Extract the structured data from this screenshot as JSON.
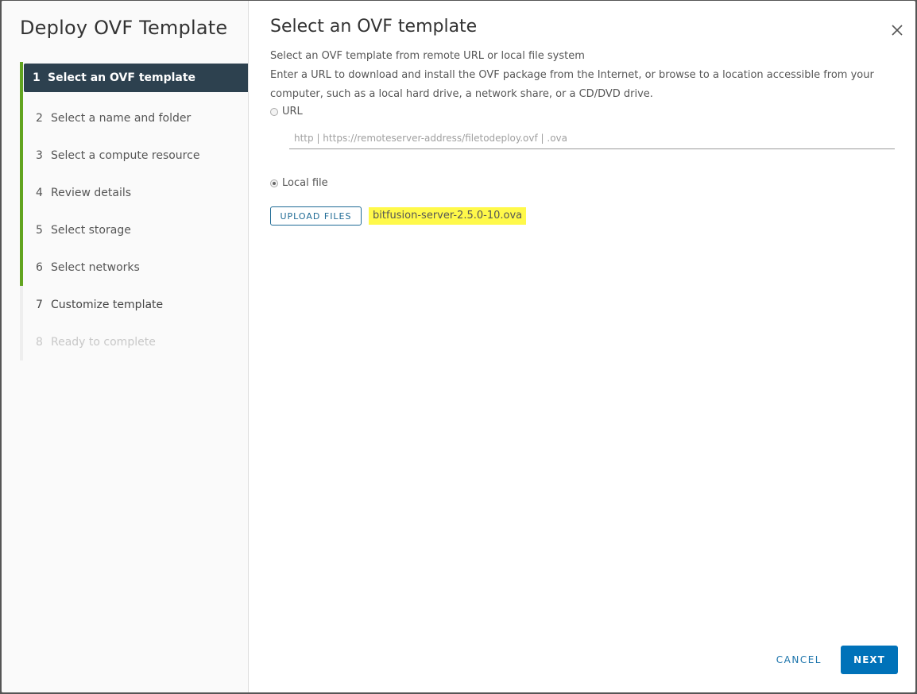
{
  "sidebar": {
    "title": "Deploy OVF Template",
    "steps": [
      {
        "num": "1",
        "label": "Select an OVF template",
        "state": "active"
      },
      {
        "num": "2",
        "label": "Select a name and folder",
        "state": "complete"
      },
      {
        "num": "3",
        "label": "Select a compute resource",
        "state": "complete"
      },
      {
        "num": "4",
        "label": "Review details",
        "state": "complete"
      },
      {
        "num": "5",
        "label": "Select storage",
        "state": "complete"
      },
      {
        "num": "6",
        "label": "Select networks",
        "state": "complete"
      },
      {
        "num": "7",
        "label": "Customize template",
        "state": "pending"
      },
      {
        "num": "8",
        "label": "Ready to complete",
        "state": "disabled"
      }
    ]
  },
  "main": {
    "title": "Select an OVF template",
    "subtitle": "Select an OVF template from remote URL or local file system",
    "description": "Enter a URL to download and install the OVF package from the Internet, or browse to a location accessible from your computer, such as a local hard drive, a network share, or a CD/DVD drive.",
    "url_option_label": "URL",
    "url_selected": false,
    "url_placeholder": "http | https://remoteserver-address/filetodeploy.ovf | .ova",
    "url_value": "",
    "local_option_label": "Local file",
    "local_selected": true,
    "upload_button_label": "UPLOAD FILES",
    "selected_file": "bitfusion-server-2.5.0-10.ova",
    "highlight_color": "#fff94a"
  },
  "footer": {
    "cancel_label": "CANCEL",
    "next_label": "NEXT"
  },
  "colors": {
    "accent": "#0072b9",
    "complete_bar": "#62a420",
    "active_step_bg": "#2d414f"
  }
}
